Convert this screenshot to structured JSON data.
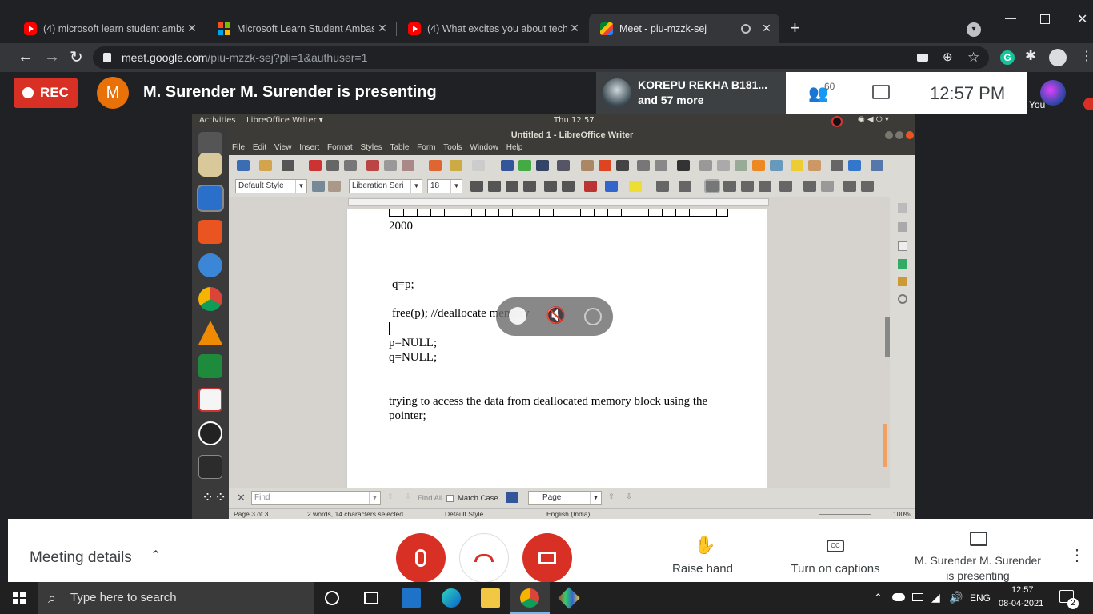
{
  "browser": {
    "tabs": [
      {
        "title": "(4) microsoft learn student amba",
        "icon": "youtube-icon"
      },
      {
        "title": "Microsoft Learn Student Ambassa",
        "icon": "microsoft-icon"
      },
      {
        "title": "(4) What excites you about techn",
        "icon": "youtube-icon"
      },
      {
        "title": "Meet - piu-mzzk-sej",
        "icon": "meet-icon"
      }
    ],
    "url_host": "meet.google.com",
    "url_path": "/piu-mzzk-sej?pli=1&authuser=1"
  },
  "meet": {
    "rec_label": "REC",
    "presenter_initial": "M",
    "presenting_text": "M. Surender M. Surender is presenting",
    "participant_name": "KOREPU REKHA B181...",
    "participant_more": "and 57 more",
    "participant_count": "60",
    "time": "12:57  PM",
    "you_label": "You",
    "meeting_details": "Meeting details",
    "raise_hand": "Raise hand",
    "captions": "Turn on captions",
    "presenting_line1": "M. Surender M. Surender",
    "presenting_line2": "is presenting"
  },
  "ubuntu": {
    "activities": "Activities",
    "app_menu": "LibreOffice Writer ▾",
    "clock": "Thu 12:57"
  },
  "writer": {
    "title": "Untitled 1 - LibreOffice Writer",
    "menus": [
      "File",
      "Edit",
      "View",
      "Insert",
      "Format",
      "Styles",
      "Table",
      "Form",
      "Tools",
      "Window",
      "Help"
    ],
    "para_style": "Default Style",
    "font_name": "Liberation Seri",
    "font_size": "18",
    "doc_lines": {
      "l1": "2000",
      "l2": "q=p;",
      "l3": "free(p); //deallocate memory",
      "l4": "p=NULL;",
      "l5": "q=NULL;",
      "l6": "trying to access the data from deallocated memory block using the",
      "l7": "pointer;"
    },
    "find_placeholder": "Find",
    "find_all": "Find All",
    "match_case": "Match Case",
    "find_target": "Page",
    "status": {
      "page": "Page 3 of 3",
      "words": "2 words, 14 characters selected",
      "style": "Default Style",
      "lang": "English (India)",
      "zoom": "100%"
    }
  },
  "windows": {
    "search_placeholder": "Type here to search",
    "lang": "ENG",
    "time": "12:57",
    "date": "08-04-2021",
    "notif_count": "2"
  },
  "colors": {
    "red": "#d93025",
    "orange": "#e8710a",
    "chrome_dark": "#202124"
  }
}
